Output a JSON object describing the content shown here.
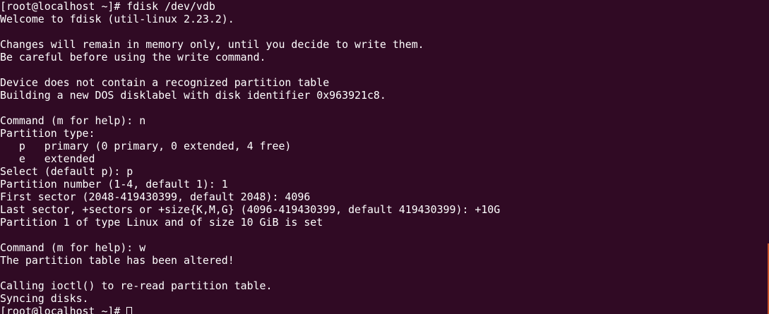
{
  "terminal": {
    "colors": {
      "background": "#300a24",
      "foreground": "#ffffff",
      "scrollbar": "#c9552b"
    },
    "lines": [
      "[root@localhost ~]# fdisk /dev/vdb",
      "Welcome to fdisk (util-linux 2.23.2).",
      "",
      "Changes will remain in memory only, until you decide to write them.",
      "Be careful before using the write command.",
      "",
      "Device does not contain a recognized partition table",
      "Building a new DOS disklabel with disk identifier 0x963921c8.",
      "",
      "Command (m for help): n",
      "Partition type:",
      "   p   primary (0 primary, 0 extended, 4 free)",
      "   e   extended",
      "Select (default p): p",
      "Partition number (1-4, default 1): 1",
      "First sector (2048-419430399, default 2048): 4096",
      "Last sector, +sectors or +size{K,M,G} (4096-419430399, default 419430399): +10G",
      "Partition 1 of type Linux and of size 10 GiB is set",
      "",
      "Command (m for help): w",
      "The partition table has been altered!",
      "",
      "Calling ioctl() to re-read partition table.",
      "Syncing disks."
    ],
    "prompt": "[root@localhost ~]# "
  }
}
